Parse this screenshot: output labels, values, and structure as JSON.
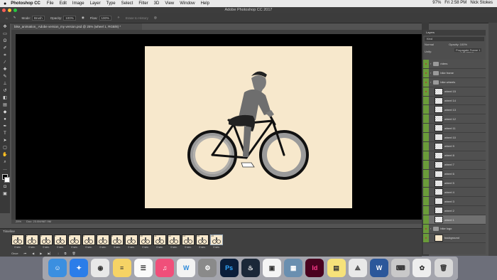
{
  "menubar": {
    "apple": "",
    "app_name": "Photoshop CC",
    "items": [
      "File",
      "Edit",
      "Image",
      "Layer",
      "Type",
      "Select",
      "Filter",
      "3D",
      "View",
      "Window",
      "Help"
    ],
    "battery": "97%",
    "clock": "Fri 2:58 PM",
    "user": "Nick Stokes"
  },
  "window": {
    "title": "Adobe Photoshop CC 2017"
  },
  "options_bar": {
    "mode_label": "Mode:",
    "mode_value": "Brush",
    "opacity_label": "Opacity:",
    "opacity_value": "100%",
    "flow_label": "Flow:",
    "flow_value": "100%",
    "erase_history": "Erase to History"
  },
  "document": {
    "tab": "bike_animation_ Adobe version_my version.psd @ 25% (wheel 1, RGB/8) *",
    "zoom": "25%",
    "doc_size": "Doc: 23.0M/987.9M"
  },
  "timeline": {
    "title": "Timeline",
    "frames": [
      {
        "num": "1",
        "dur": "0 sec."
      },
      {
        "num": "2",
        "dur": "0 sec."
      },
      {
        "num": "3",
        "dur": "0 sec."
      },
      {
        "num": "4",
        "dur": "0 sec."
      },
      {
        "num": "5",
        "dur": "0 sec."
      },
      {
        "num": "6",
        "dur": "0 sec."
      },
      {
        "num": "7",
        "dur": "0 sec."
      },
      {
        "num": "8",
        "dur": "0 sec."
      },
      {
        "num": "9",
        "dur": "0 sec."
      },
      {
        "num": "10",
        "dur": "0 sec."
      },
      {
        "num": "11",
        "dur": "0 sec."
      },
      {
        "num": "12",
        "dur": "0 sec."
      },
      {
        "num": "13",
        "dur": "0 sec."
      },
      {
        "num": "14",
        "dur": "0 sec."
      },
      {
        "num": "15",
        "dur": "0 sec."
      }
    ],
    "loop": "Once"
  },
  "layers_panel": {
    "tab": "Layers",
    "kind": "Kind",
    "blend": "Normal",
    "opacity": "Opacity: 100%",
    "unify": "Unify:",
    "propagate": "Propagate Frame 1",
    "lock": "Lock:",
    "fill": "Fill: 100%",
    "layers": [
      {
        "name": "riders",
        "type": "folder",
        "visible": true
      },
      {
        "name": "bike frame",
        "type": "folder",
        "visible": true
      },
      {
        "name": "bike wheels",
        "type": "folder",
        "visible": true
      },
      {
        "name": "wheel 15",
        "type": "layer",
        "visible": true
      },
      {
        "name": "wheel 14",
        "type": "layer",
        "visible": false
      },
      {
        "name": "wheel 13",
        "type": "layer",
        "visible": false
      },
      {
        "name": "wheel 12",
        "type": "layer",
        "visible": false
      },
      {
        "name": "wheel 11",
        "type": "layer",
        "visible": false
      },
      {
        "name": "wheel 10",
        "type": "layer",
        "visible": false
      },
      {
        "name": "wheel 9",
        "type": "layer",
        "visible": false
      },
      {
        "name": "wheel 8",
        "type": "layer",
        "visible": false
      },
      {
        "name": "wheel 7",
        "type": "layer",
        "visible": false
      },
      {
        "name": "wheel 6",
        "type": "layer",
        "visible": false
      },
      {
        "name": "wheel 5",
        "type": "layer",
        "visible": false
      },
      {
        "name": "wheel 4",
        "type": "layer",
        "visible": false
      },
      {
        "name": "wheel 3",
        "type": "layer",
        "visible": false
      },
      {
        "name": "wheel 2",
        "type": "layer",
        "visible": false
      },
      {
        "name": "wheel 1",
        "type": "layer",
        "visible": false,
        "selected": true
      },
      {
        "name": "bike logo",
        "type": "folder",
        "visible": true
      },
      {
        "name": "background",
        "type": "layer",
        "visible": true
      }
    ]
  },
  "colors": {
    "artboard": "#f7e8cc",
    "layer_highlight": "#6a9b3a",
    "eye_red": "#b03030"
  },
  "dock": {
    "apps": [
      "finder-icon",
      "safari-icon",
      "chrome-icon",
      "notes-icon",
      "reminders-icon",
      "itunes-icon",
      "wunderlist-icon",
      "system-preferences-icon",
      "photoshop-icon",
      "steam-icon",
      "messenger-icon",
      "preview-icon",
      "indesign-icon",
      "stickies-icon",
      "acrobat-icon",
      "word-icon",
      "keyboard-icon",
      "photos-icon",
      "trash-icon"
    ],
    "ps_label": "Ps",
    "id_label": "Id",
    "word_label": "W",
    "wunder_label": "W"
  }
}
